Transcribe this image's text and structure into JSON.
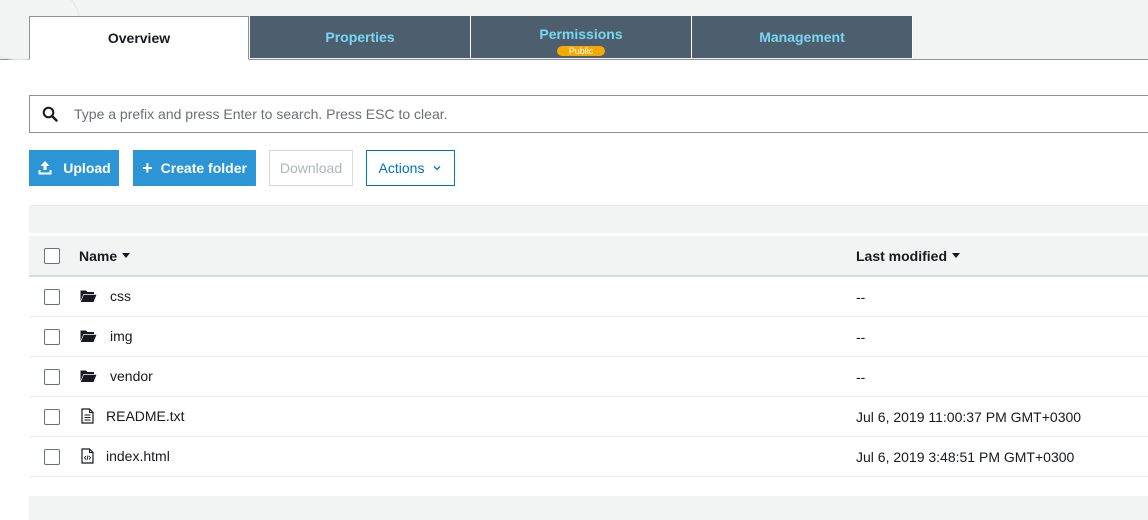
{
  "tabs": [
    {
      "label": "Overview",
      "active": true
    },
    {
      "label": "Properties",
      "active": false
    },
    {
      "label": "Permissions",
      "active": false,
      "badge": "Public"
    },
    {
      "label": "Management",
      "active": false
    }
  ],
  "search": {
    "placeholder": "Type a prefix and press Enter to search. Press ESC to clear.",
    "value": "",
    "icon": "search-icon"
  },
  "toolbar": {
    "upload_label": "Upload",
    "create_folder_label": "Create folder",
    "download_label": "Download",
    "actions_label": "Actions"
  },
  "table": {
    "columns": {
      "name": "Name",
      "last_modified": "Last modified"
    },
    "rows": [
      {
        "type": "folder",
        "name": "css",
        "last_modified": "--"
      },
      {
        "type": "folder",
        "name": "img",
        "last_modified": "--"
      },
      {
        "type": "folder",
        "name": "vendor",
        "last_modified": "--"
      },
      {
        "type": "text-file",
        "name": "README.txt",
        "last_modified": "Jul 6, 2019 11:00:37 PM GMT+0300"
      },
      {
        "type": "code-file",
        "name": "index.html",
        "last_modified": "Jul 6, 2019 3:48:51 PM GMT+0300"
      }
    ]
  },
  "colors": {
    "accent": "#2b95d6",
    "tab_bg": "#4d5f6e",
    "tab_text": "#78d7f0",
    "badge": "#f7a800"
  }
}
